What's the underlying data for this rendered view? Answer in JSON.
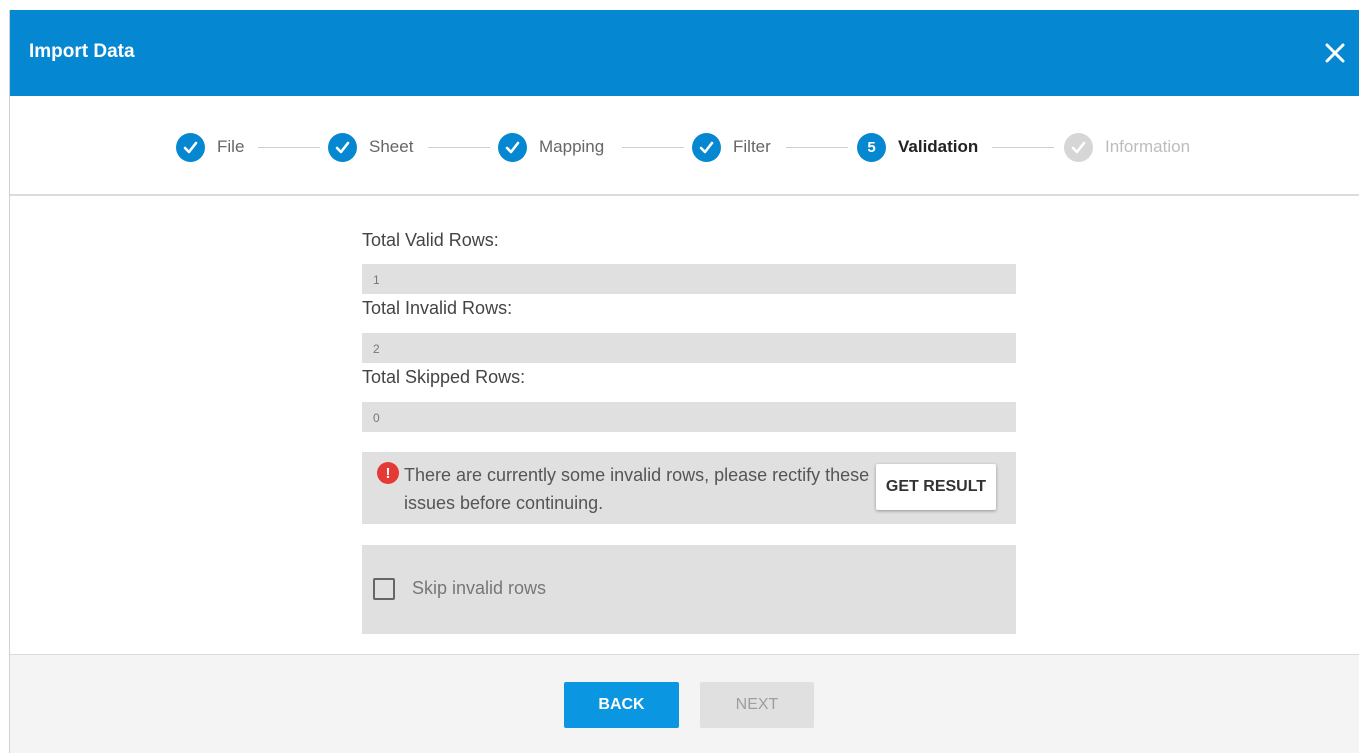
{
  "dialog": {
    "title": "Import Data"
  },
  "steps": [
    {
      "label": "File",
      "state": "done"
    },
    {
      "label": "Sheet",
      "state": "done"
    },
    {
      "label": "Mapping",
      "state": "done"
    },
    {
      "label": "Filter",
      "state": "done"
    },
    {
      "label": "Validation",
      "state": "active",
      "number": "5"
    },
    {
      "label": "Information",
      "state": "pending"
    }
  ],
  "fields": {
    "valid": {
      "label": "Total Valid Rows:",
      "value": "1"
    },
    "invalid": {
      "label": "Total Invalid Rows:",
      "value": "2"
    },
    "skipped": {
      "label": "Total Skipped Rows:",
      "value": "0"
    }
  },
  "alert": {
    "icon_text": "!",
    "message": "There are currently some invalid rows, please rectify these issues before continuing.",
    "button": "GET RESULT"
  },
  "skip": {
    "label": "Skip invalid rows",
    "checked": false
  },
  "footer": {
    "back": "BACK",
    "next": "NEXT"
  },
  "colors": {
    "primary": "#0588d1",
    "error": "#e53935",
    "panel": "#e0e0e0"
  }
}
